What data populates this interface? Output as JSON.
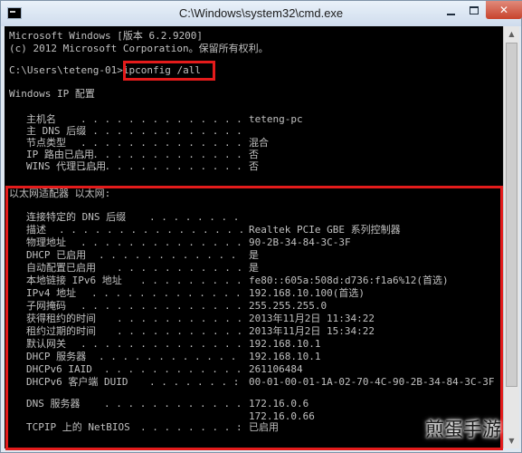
{
  "window": {
    "title": "C:\\Windows\\system32\\cmd.exe",
    "close_glyph": "✕"
  },
  "header": [
    "Microsoft Windows [版本 6.2.9200]",
    "(c) 2012 Microsoft Corporation。保留所有权利。"
  ],
  "prompt": {
    "path": "C:\\Users\\teteng-01>",
    "command": "ipconfig /all"
  },
  "windows_ip_heading": "Windows IP 配置",
  "ip_config": [
    {
      "label": "主机名",
      "value": "teteng-pc"
    },
    {
      "label": "主 DNS 后缀",
      "value": ""
    },
    {
      "label": "节点类型",
      "value": "混合"
    },
    {
      "label": "IP 路由已启用",
      "value": "否"
    },
    {
      "label": "WINS 代理已启用",
      "value": "否"
    }
  ],
  "adapter_heading": "以太网适配器 以太网:",
  "adapter": [
    {
      "label": "连接特定的 DNS 后缀",
      "value": ""
    },
    {
      "label": "描述",
      "value": "Realtek PCIe GBE 系列控制器"
    },
    {
      "label": "物理地址",
      "value": "90-2B-34-84-3C-3F"
    },
    {
      "label": "DHCP 已启用",
      "value": "是"
    },
    {
      "label": "自动配置已启用",
      "value": "是"
    },
    {
      "label": "本地链接 IPv6 地址",
      "value": "fe80::605a:508d:d736:f1a6%12(首选)"
    },
    {
      "label": "IPv4 地址",
      "value": "192.168.10.100(首选)"
    },
    {
      "label": "子网掩码",
      "value": "255.255.255.0"
    },
    {
      "label": "获得租约的时间",
      "value": "2013年11月2日 11:34:22"
    },
    {
      "label": "租约过期的时间",
      "value": "2013年11月2日 15:34:22"
    },
    {
      "label": "默认网关",
      "value": "192.168.10.1"
    },
    {
      "label": "DHCP 服务器",
      "value": "192.168.10.1"
    },
    {
      "label": "DHCPv6 IAID",
      "value": "261106484"
    },
    {
      "label": "DHCPv6 客户端 DUID",
      "value": "00-01-00-01-1A-02-70-4C-90-2B-34-84-3C-3F"
    }
  ],
  "dns": [
    {
      "label": "DNS 服务器",
      "value": "172.16.0.6"
    },
    {
      "label": "",
      "value": "172.16.0.66"
    }
  ],
  "netbios": {
    "label": "TCPIP 上的 NetBIOS",
    "value": "已启用"
  },
  "watermark": "煎蛋手游"
}
